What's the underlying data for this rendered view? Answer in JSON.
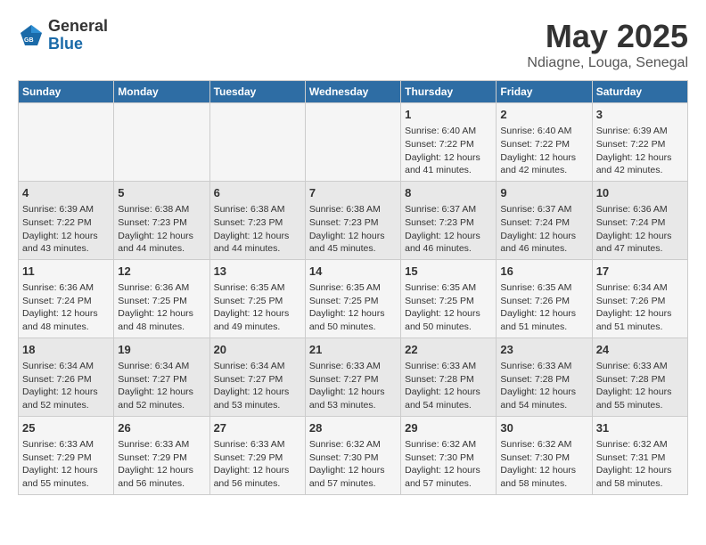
{
  "header": {
    "logo_general": "General",
    "logo_blue": "Blue",
    "title": "May 2025",
    "subtitle": "Ndiagne, Louga, Senegal"
  },
  "days_of_week": [
    "Sunday",
    "Monday",
    "Tuesday",
    "Wednesday",
    "Thursday",
    "Friday",
    "Saturday"
  ],
  "weeks": [
    [
      {
        "day": "",
        "content": ""
      },
      {
        "day": "",
        "content": ""
      },
      {
        "day": "",
        "content": ""
      },
      {
        "day": "",
        "content": ""
      },
      {
        "day": "1",
        "content": "Sunrise: 6:40 AM\nSunset: 7:22 PM\nDaylight: 12 hours\nand 41 minutes."
      },
      {
        "day": "2",
        "content": "Sunrise: 6:40 AM\nSunset: 7:22 PM\nDaylight: 12 hours\nand 42 minutes."
      },
      {
        "day": "3",
        "content": "Sunrise: 6:39 AM\nSunset: 7:22 PM\nDaylight: 12 hours\nand 42 minutes."
      }
    ],
    [
      {
        "day": "4",
        "content": "Sunrise: 6:39 AM\nSunset: 7:22 PM\nDaylight: 12 hours\nand 43 minutes."
      },
      {
        "day": "5",
        "content": "Sunrise: 6:38 AM\nSunset: 7:23 PM\nDaylight: 12 hours\nand 44 minutes."
      },
      {
        "day": "6",
        "content": "Sunrise: 6:38 AM\nSunset: 7:23 PM\nDaylight: 12 hours\nand 44 minutes."
      },
      {
        "day": "7",
        "content": "Sunrise: 6:38 AM\nSunset: 7:23 PM\nDaylight: 12 hours\nand 45 minutes."
      },
      {
        "day": "8",
        "content": "Sunrise: 6:37 AM\nSunset: 7:23 PM\nDaylight: 12 hours\nand 46 minutes."
      },
      {
        "day": "9",
        "content": "Sunrise: 6:37 AM\nSunset: 7:24 PM\nDaylight: 12 hours\nand 46 minutes."
      },
      {
        "day": "10",
        "content": "Sunrise: 6:36 AM\nSunset: 7:24 PM\nDaylight: 12 hours\nand 47 minutes."
      }
    ],
    [
      {
        "day": "11",
        "content": "Sunrise: 6:36 AM\nSunset: 7:24 PM\nDaylight: 12 hours\nand 48 minutes."
      },
      {
        "day": "12",
        "content": "Sunrise: 6:36 AM\nSunset: 7:25 PM\nDaylight: 12 hours\nand 48 minutes."
      },
      {
        "day": "13",
        "content": "Sunrise: 6:35 AM\nSunset: 7:25 PM\nDaylight: 12 hours\nand 49 minutes."
      },
      {
        "day": "14",
        "content": "Sunrise: 6:35 AM\nSunset: 7:25 PM\nDaylight: 12 hours\nand 50 minutes."
      },
      {
        "day": "15",
        "content": "Sunrise: 6:35 AM\nSunset: 7:25 PM\nDaylight: 12 hours\nand 50 minutes."
      },
      {
        "day": "16",
        "content": "Sunrise: 6:35 AM\nSunset: 7:26 PM\nDaylight: 12 hours\nand 51 minutes."
      },
      {
        "day": "17",
        "content": "Sunrise: 6:34 AM\nSunset: 7:26 PM\nDaylight: 12 hours\nand 51 minutes."
      }
    ],
    [
      {
        "day": "18",
        "content": "Sunrise: 6:34 AM\nSunset: 7:26 PM\nDaylight: 12 hours\nand 52 minutes."
      },
      {
        "day": "19",
        "content": "Sunrise: 6:34 AM\nSunset: 7:27 PM\nDaylight: 12 hours\nand 52 minutes."
      },
      {
        "day": "20",
        "content": "Sunrise: 6:34 AM\nSunset: 7:27 PM\nDaylight: 12 hours\nand 53 minutes."
      },
      {
        "day": "21",
        "content": "Sunrise: 6:33 AM\nSunset: 7:27 PM\nDaylight: 12 hours\nand 53 minutes."
      },
      {
        "day": "22",
        "content": "Sunrise: 6:33 AM\nSunset: 7:28 PM\nDaylight: 12 hours\nand 54 minutes."
      },
      {
        "day": "23",
        "content": "Sunrise: 6:33 AM\nSunset: 7:28 PM\nDaylight: 12 hours\nand 54 minutes."
      },
      {
        "day": "24",
        "content": "Sunrise: 6:33 AM\nSunset: 7:28 PM\nDaylight: 12 hours\nand 55 minutes."
      }
    ],
    [
      {
        "day": "25",
        "content": "Sunrise: 6:33 AM\nSunset: 7:29 PM\nDaylight: 12 hours\nand 55 minutes."
      },
      {
        "day": "26",
        "content": "Sunrise: 6:33 AM\nSunset: 7:29 PM\nDaylight: 12 hours\nand 56 minutes."
      },
      {
        "day": "27",
        "content": "Sunrise: 6:33 AM\nSunset: 7:29 PM\nDaylight: 12 hours\nand 56 minutes."
      },
      {
        "day": "28",
        "content": "Sunrise: 6:32 AM\nSunset: 7:30 PM\nDaylight: 12 hours\nand 57 minutes."
      },
      {
        "day": "29",
        "content": "Sunrise: 6:32 AM\nSunset: 7:30 PM\nDaylight: 12 hours\nand 57 minutes."
      },
      {
        "day": "30",
        "content": "Sunrise: 6:32 AM\nSunset: 7:30 PM\nDaylight: 12 hours\nand 58 minutes."
      },
      {
        "day": "31",
        "content": "Sunrise: 6:32 AM\nSunset: 7:31 PM\nDaylight: 12 hours\nand 58 minutes."
      }
    ]
  ]
}
